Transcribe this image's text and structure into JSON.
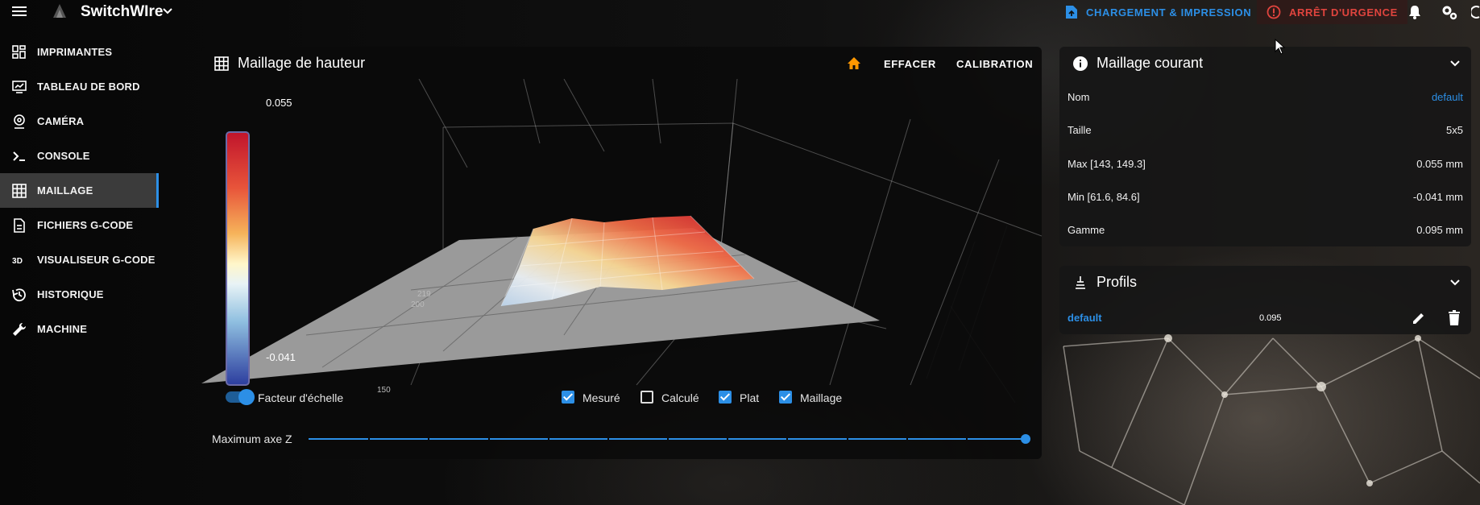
{
  "app": {
    "title": "SwitchWIre"
  },
  "topbar": {
    "print_label": "CHARGEMENT & IMPRESSION",
    "estop_label": "ARRÊT D'URGENCE",
    "accent": "#2c8fe6",
    "danger": "#e0443e"
  },
  "sidebar": {
    "items": [
      {
        "label": "IMPRIMANTES",
        "icon": "printers-grid-icon"
      },
      {
        "label": "TABLEAU DE BORD",
        "icon": "dashboard-icon"
      },
      {
        "label": "CAMÉRA",
        "icon": "camera-icon"
      },
      {
        "label": "CONSOLE",
        "icon": "console-icon"
      },
      {
        "label": "MAILLAGE",
        "icon": "grid-icon",
        "active": true
      },
      {
        "label": "FICHIERS G-CODE",
        "icon": "file-icon"
      },
      {
        "label": "VISUALISEUR G-CODE",
        "icon": "3d-icon"
      },
      {
        "label": "HISTORIQUE",
        "icon": "history-icon"
      },
      {
        "label": "MACHINE",
        "icon": "wrench-icon"
      }
    ]
  },
  "mesh_card": {
    "title": "Maillage de hauteur",
    "clear_label": "EFFACER",
    "calibrate_label": "CALIBRATION",
    "scale": {
      "max": "0.055",
      "min": "-0.041"
    },
    "axis_ticks": [
      "219",
      "200",
      "150"
    ],
    "scale_factor_label": "Facteur d'échelle",
    "scale_factor_on": true,
    "options": [
      {
        "label": "Mesuré",
        "checked": true
      },
      {
        "label": "Calculé",
        "checked": false
      },
      {
        "label": "Plat",
        "checked": true
      },
      {
        "label": "Maillage",
        "checked": true
      }
    ],
    "z_axis_label": "Maximum axe Z",
    "z_axis_level": 1.0
  },
  "current_mesh": {
    "title": "Maillage courant",
    "rows": [
      {
        "key": "Nom",
        "value": "default",
        "link": true
      },
      {
        "key": "Taille",
        "value": "5x5"
      },
      {
        "key": "Max [143, 149.3]",
        "value": "0.055 mm"
      },
      {
        "key": "Min [61.6, 84.6]",
        "value": "-0.041 mm"
      },
      {
        "key": "Gamme",
        "value": "0.095 mm"
      }
    ]
  },
  "profiles": {
    "title": "Profils",
    "items": [
      {
        "name": "default",
        "range": "0.095"
      }
    ]
  }
}
